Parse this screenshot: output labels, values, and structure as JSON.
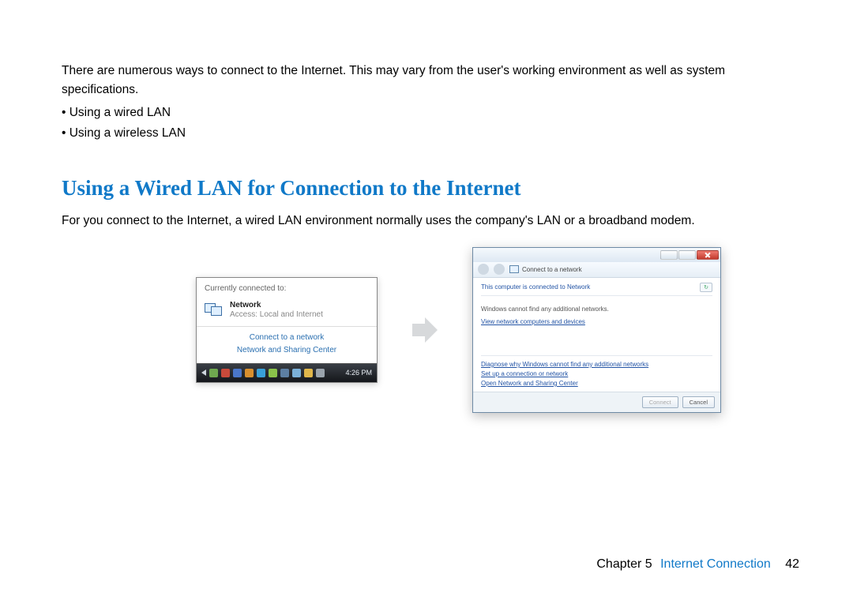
{
  "intro": "There are numerous ways to connect to the Internet. This may vary from the user's working environment as well as system specifications.",
  "bullets": [
    "Using a wired LAN",
    "Using a wireless LAN"
  ],
  "heading": "Using a Wired LAN for Connection to the Internet",
  "paragraph": "For you connect to the Internet, a wired LAN environment normally uses the company's LAN or a broadband modem.",
  "fig1": {
    "header": "Currently connected to:",
    "network_name": "Network",
    "network_access_label": "Access:",
    "network_access_value": "Local and Internet",
    "link_connect": "Connect to a network",
    "link_center": "Network and Sharing Center",
    "tray_time": "4:26 PM"
  },
  "fig2": {
    "window_title": "Connect to a network",
    "status": "This computer is connected to Network",
    "msg": "Windows cannot find any additional networks.",
    "link_view": "View network computers and devices",
    "link_diagnose": "Diagnose why Windows cannot find any additional networks",
    "link_setup": "Set up a connection or network",
    "link_open_center": "Open Network and Sharing Center",
    "btn_connect": "Connect",
    "btn_cancel": "Cancel"
  },
  "footer": {
    "chapter": "Chapter 5",
    "title": "Internet Connection",
    "page": "42"
  }
}
